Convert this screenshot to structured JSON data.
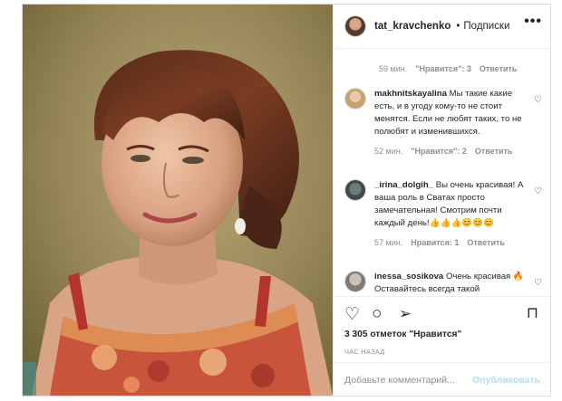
{
  "post": {
    "header": {
      "username": "tat_kravchenko",
      "separator": "•",
      "follow": "Подписки",
      "more": "•••"
    },
    "first_meta": {
      "time": "59 мин.",
      "likes": "\"Нравится\": 3",
      "reply": "Ответить"
    },
    "comments": [
      {
        "username": "makhnitskayalina",
        "text": "Мы такие какие есть, и в угоду кому-то не стоит менятся. Если не любят таких, то не полюбят и изменившихся.",
        "time": "52 мин.",
        "likes": "\"Нравится\": 2",
        "reply": "Ответить"
      },
      {
        "username": "_irina_dolgih_",
        "text": "Вы очень красивая! А ваша роль в Сватах просто замечательная! Смотрим почти каждый день!👍👍👍😊😊😊",
        "time": "57 мин.",
        "likes": "Нравится: 1",
        "reply": "Ответить"
      },
      {
        "username": "inessa_sosikova",
        "text": "Очень красивая 🔥Оставайтесь всегда такой",
        "time": "",
        "likes": "",
        "reply": ""
      }
    ],
    "likes_count": "3 305 отметок \"Нравится\"",
    "posted": "ЧАС НАЗАД",
    "comment_input": {
      "placeholder": "Добавьте комментарий...",
      "publish": "Опубликовать"
    },
    "icons": {
      "like": "heart-icon",
      "comment": "comment-icon",
      "share": "share-icon",
      "save": "bookmark-icon"
    },
    "colors": {
      "publish_disabled": "#b2dffc",
      "muted": "#8e8e8e"
    }
  }
}
